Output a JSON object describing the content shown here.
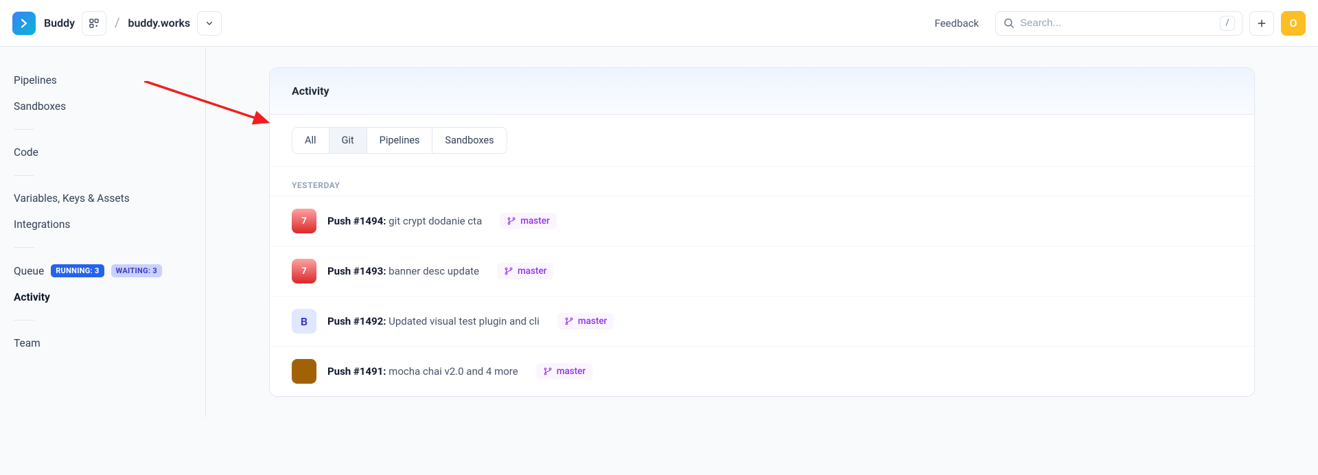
{
  "header": {
    "brand": "Buddy",
    "crumb": "buddy.works",
    "feedback": "Feedback",
    "search_placeholder": "Search...",
    "search_kbd": "/",
    "avatar_letter": "O"
  },
  "sidebar": {
    "pipelines": "Pipelines",
    "sandboxes": "Sandboxes",
    "code": "Code",
    "vars": "Variables, Keys & Assets",
    "integrations": "Integrations",
    "queue": "Queue",
    "queue_running": "RUNNING: 3",
    "queue_waiting": "WAITING: 3",
    "activity": "Activity",
    "team": "Team"
  },
  "activity": {
    "title": "Activity",
    "tabs": {
      "all": "All",
      "git": "Git",
      "pipelines": "Pipelines",
      "sandboxes": "Sandboxes"
    },
    "section_yesterday": "YESTERDAY",
    "rows": [
      {
        "push": "Push #1494:",
        "msg": " git crypt dodanie cta",
        "branch": "master",
        "avatar": "7"
      },
      {
        "push": "Push #1493:",
        "msg": " banner desc update",
        "branch": "master",
        "avatar": "7"
      },
      {
        "push": "Push #1492:",
        "msg": " Updated visual test plugin and cli",
        "branch": "master",
        "avatar": "B"
      },
      {
        "push": "Push #1491:",
        "msg": " mocha chai v2.0 and 4 more",
        "branch": "master",
        "avatar": ""
      }
    ]
  }
}
